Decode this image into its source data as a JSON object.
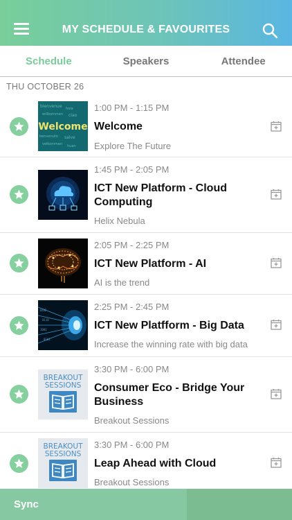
{
  "header": {
    "title": "MY SCHEDULE & FAVOURITES",
    "menu_icon": "hamburger-menu-icon",
    "search_icon": "search-icon"
  },
  "tabs": [
    {
      "label": "Schedule",
      "active": true
    },
    {
      "label": "Speakers",
      "active": false
    },
    {
      "label": "Attendee",
      "active": false
    }
  ],
  "date_label": "THU OCTOBER 26",
  "sessions": [
    {
      "time": "1:00 PM - 1:15 PM",
      "title": "Welcome",
      "subtitle": "Explore The Future",
      "thumb": "welcome-word-cloud"
    },
    {
      "time": "1:45 PM - 2:05 PM",
      "title": "ICT New Platform - Cloud Computing",
      "subtitle": "Helix Nebula",
      "thumb": "cloud-computing"
    },
    {
      "time": "2:05 PM - 2:25 PM",
      "title": "ICT New Platform - AI",
      "subtitle": "AI is the trend",
      "thumb": "ai-brain"
    },
    {
      "time": "2:25 PM - 2:45 PM",
      "title": "ICT New Platfform - Big Data",
      "subtitle": "Increase the winning rate with big data",
      "thumb": "big-data-tunnel"
    },
    {
      "time": "3:30 PM - 6:00 PM",
      "title": "Consumer Eco - Bridge Your Business",
      "subtitle": "Breakout Sessions",
      "thumb": "breakout-sessions"
    },
    {
      "time": "3:30 PM - 6:00 PM",
      "title": "Leap Ahead with Cloud",
      "subtitle": "Breakout Sessions",
      "thumb": "breakout-sessions"
    }
  ],
  "thumb_text": {
    "welcome": "Welcome",
    "breakout": "BREAKOUT",
    "sessions": "SESSIONS"
  },
  "footer": {
    "sync_label": "Sync"
  },
  "colors": {
    "accent_green": "#7acb9a",
    "star_green": "#86cf9f",
    "header_gradient_start": "#79ce9a",
    "header_gradient_end": "#5ab6e2"
  }
}
